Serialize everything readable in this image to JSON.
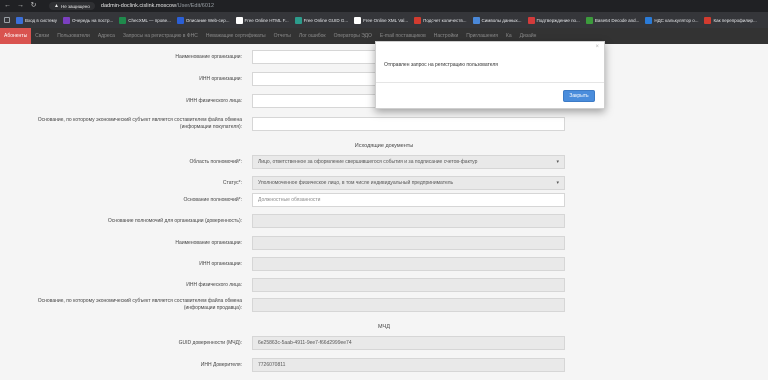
{
  "browser": {
    "back": "←",
    "forward": "→",
    "reload": "↻",
    "security_label": "Не защищено",
    "url_host": "dadmin-doclink.cislink.moscow",
    "url_path": "/User/Edit/6012",
    "bookmarks": [
      {
        "label": "Вход в систему",
        "color": "#3b6fd8"
      },
      {
        "label": "Очередь на постр...",
        "color": "#7b3fc0"
      },
      {
        "label": "ChecXML — прове...",
        "color": "#1f8a4c"
      },
      {
        "label": "Описание Web-сер...",
        "color": "#2b5fd6"
      },
      {
        "label": "Free Online HTML F...",
        "color": "#ffffff"
      },
      {
        "label": "Free Online GUID G...",
        "color": "#2c9c8c"
      },
      {
        "label": "Free Online XML Val...",
        "color": "#ffffff"
      },
      {
        "label": "Подсчет количеств...",
        "color": "#d23b2f"
      },
      {
        "label": "Символы данных...",
        "color": "#4a88d8"
      },
      {
        "label": "Подтверждение по...",
        "color": "#d33b3b"
      },
      {
        "label": "Base64 Decode and...",
        "color": "#3c9b3c"
      },
      {
        "label": "НДС калькулятор о...",
        "color": "#2a7bd8"
      },
      {
        "label": "Как перепрофилир...",
        "color": "#d23b2f"
      }
    ]
  },
  "nav": {
    "tabs": [
      {
        "label": "Абоненты",
        "active": true
      },
      {
        "label": "Связи"
      },
      {
        "label": "Пользователи"
      },
      {
        "label": "Адреса"
      },
      {
        "label": "Запросы на регистрацию в ФНС"
      },
      {
        "label": "Неважащие сертификаты"
      },
      {
        "label": "Отчеты"
      },
      {
        "label": "Лог ошибок"
      },
      {
        "label": "Операторы ЭДО"
      },
      {
        "label": "E-mail поставщиков"
      },
      {
        "label": "Настройки"
      },
      {
        "label": "Приглашения"
      },
      {
        "label": "Ка"
      },
      {
        "label": "Дизайн"
      }
    ]
  },
  "form": {
    "org_name_label": "Наименование организации:",
    "org_name_value": "",
    "org_inn_label": "ИНН организации:",
    "org_inn_value": "",
    "person_inn_label": "ИНН физического лица:",
    "person_inn_value": "",
    "basis_buyer_label": "Основание, по которому экономический субъект является составителем файла обмена (информации покупателя):",
    "basis_buyer_value": "",
    "outgoing_section": "Исходящие документы",
    "authority_area_label": "Область полномочий*:",
    "authority_area_value": "Лицо, ответственное за оформление свершившегося события и за подписание счетов-фактур",
    "status_label": "Статус*:",
    "status_value": "Уполномоченное физическое лицо, в том числе индивидуальный предприниматель",
    "authority_basis_label": "Основание полномочий*:",
    "authority_basis_placeholder": "Должностные обязанности",
    "org_authority_basis_label": "Основание полномочий для организации (доверенность):",
    "org_authority_basis_value": "",
    "org_name2_label": "Наименование организации:",
    "org_name2_value": "",
    "org_inn2_label": "ИНН организации:",
    "org_inn2_value": "",
    "person_inn2_label": "ИНН физического лица:",
    "person_inn2_value": "",
    "basis_seller_label": "Основание, по которому экономический субъект является составителем файла обмена (информации продавца):",
    "basis_seller_value": "",
    "mchd_section": "МЧД",
    "guid_label": "GUID доверенности (МЧД):",
    "guid_value": "6e25863c-5aab-4911-9ee7-f66d2999ee74",
    "inn_trustor_label": "ИНН Доверителя:",
    "inn_trustor_value": "7726070811"
  },
  "modal": {
    "close": "×",
    "message": "Отправлен запрос на регистрацию пользователя",
    "ok_label": "Закрыть"
  }
}
